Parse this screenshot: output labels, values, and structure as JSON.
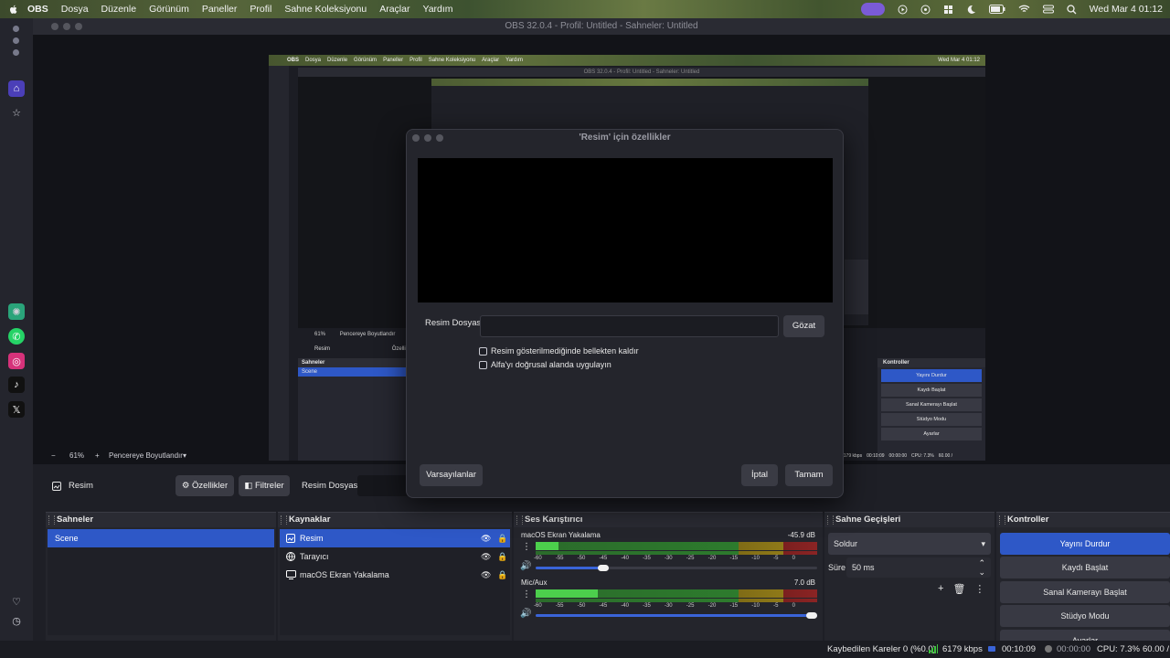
{
  "menubar": {
    "apple": "",
    "app": "OBS",
    "items": [
      "Dosya",
      "Düzenle",
      "Görünüm",
      "Paneller",
      "Profil",
      "Sahne Koleksiyonu",
      "Araçlar",
      "Yardım"
    ],
    "clock": "Wed Mar 4  01:12"
  },
  "window": {
    "title": "OBS 32.0.4 - Profil: Untitled - Sahneler: Untitled"
  },
  "nested": {
    "title": "OBS 32.0.4 - Profil: Untitled - Sahneler: Untitled",
    "menu": [
      "OBS",
      "Dosya",
      "Düzenle",
      "Görünüm",
      "Paneller",
      "Profil",
      "Sahne Koleksiyonu",
      "Araçlar",
      "Yardım"
    ],
    "clock": "Wed Mar 4  01:12",
    "zoom": "61%",
    "fit": "Pencereye Boyutlandır",
    "source": "Resim",
    "props": "Özellikler",
    "scenes_header": "Sahneler",
    "scene": "Scene",
    "controls_header": "Kontroller",
    "controls": [
      "Yayını Durdur",
      "Kaydı Başlat",
      "Sanal Kamerayı Başlat",
      "Stüdyo Modu",
      "Ayarlar"
    ],
    "status": [
      "6179 kbps",
      "00:10:09",
      "00:00:00",
      "CPU: 7.3%",
      "60.00 /"
    ]
  },
  "dialog": {
    "title": "'Resim' için özellikler",
    "file_label": "Resim Dosyası",
    "file_value": "",
    "browse": "Gözat",
    "unload_label": "Resim gösterilmediğinde bellekten kaldır",
    "linear_alpha_label": "Alfa'yı doğrusal alanda uygulayın",
    "defaults": "Varsayılanlar",
    "cancel": "İptal",
    "ok": "Tamam"
  },
  "toolbar": {
    "zoom": "61%",
    "fit": "Pencereye Boyutlandır",
    "source_name": "Resim",
    "properties": "Özellikler",
    "filters": "Filtreler",
    "file_label": "Resim Dosyası"
  },
  "scenes": {
    "header": "Sahneler",
    "items": [
      "Scene"
    ]
  },
  "sources": {
    "header": "Kaynaklar",
    "items": [
      {
        "name": "Resim",
        "icon": "image-icon"
      },
      {
        "name": "Tarayıcı",
        "icon": "browser-icon"
      },
      {
        "name": "macOS Ekran Yakalama",
        "icon": "display-icon"
      }
    ]
  },
  "mixer": {
    "header": "Ses Karıştırıcı",
    "scale": [
      "-60",
      "-55",
      "-50",
      "-45",
      "-40",
      "-35",
      "-30",
      "-25",
      "-20",
      "-15",
      "-10",
      "-5",
      "0"
    ],
    "channels": [
      {
        "name": "macOS Ekran Yakalama",
        "db": "-45.9 dB",
        "level": 0.08,
        "volume": 0.24
      },
      {
        "name": "Mic/Aux",
        "db": "7.0 dB",
        "level": 0.22,
        "volume": 1.0
      }
    ]
  },
  "transitions": {
    "header": "Sahne Geçişleri",
    "type": "Soldur",
    "duration_label": "Süre",
    "duration": "50 ms"
  },
  "controls": {
    "header": "Kontroller",
    "buttons": [
      "Yayını Durdur",
      "Kaydı Başlat",
      "Sanal Kamerayı Başlat",
      "Stüdyo Modu",
      "Ayarlar"
    ]
  },
  "status": {
    "dropped": "Kaybedilen Kareler 0 (%0.0)",
    "bitrate": "6179 kbps",
    "stream_time": "00:10:09",
    "rec_time": "00:00:00",
    "cpu": "CPU: 7.3%",
    "fps": "60.00 / 6"
  }
}
